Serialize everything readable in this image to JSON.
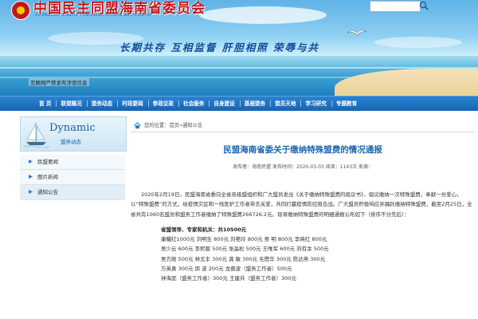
{
  "header": {
    "site_title": "中国民主同盟海南省委员会",
    "site_subtitle": "ZHONGGUO MINZHU TONGMENG HAINAN WEIYUANHUI",
    "slogan": "长期共存  互相监督  肝胆相照  荣辱与共",
    "notice": "互联网严禁发布涉密信息",
    "search_placeholder": ""
  },
  "nav": {
    "items": [
      "首 页",
      "联盟概况",
      "盟务动态",
      "时政要闻",
      "参政议政",
      "社会服务",
      "自身建设",
      "基层盟务",
      "盟员天地",
      "学习研究",
      "专题教育"
    ]
  },
  "sidebar": {
    "dynamic_title": "Dynamic",
    "dynamic_subtitle": "盟务动态",
    "items": [
      {
        "label": "民盟要闻",
        "active": false
      },
      {
        "label": "图片新闻",
        "active": false
      },
      {
        "label": "通知公告",
        "active": true
      }
    ]
  },
  "breadcrumb": {
    "prefix": "您的位置：",
    "path": "首页»通知公告"
  },
  "article": {
    "title": "民盟海南省委关于缴纳特殊盟费的情况通报",
    "meta": "发布者：海南民盟   发布时间：2020-03-03   阅读：1143次   来源：",
    "paragraph": "2020年2月19日，民盟海南省委向全省各级盟组织和广大盟员发出《关于缴纳特殊盟费的倡议书》，倡议缴纳一次特殊盟费，奉献一份爱心，以“特殊盟费”的方式，给疫情灾区和一线医护工作者带去关爱，共同打赢疫情防控阻击战。广大盟员积极响应并踊跃缴纳特殊盟费，截至2月25日，全省共有1060名盟员和盟务工作者缴纳了特殊盟费266726.2元。现将缴纳特殊盟费的明细通报公布如下（排序不分先后）：",
    "section_title": "省盟领导、专家和机关：共10500元",
    "donor_lines": [
      "康耀红1000元   刘明生 800元   刘艳玲 800元   吴  明 800元   李映红 800元",
      "吴少云 600元   李熙蓉 500元   张晶松 500元   王唯军 600元   刘有余 500元",
      "吴方刚 500元   林尤丰 300元   龚  敏 300元   毛懋华 300元   陈达燕 300元",
      "万英勇 300元   邱  波 200元   龙蓉波（盟务工作者）500元",
      "钟海武（盟务工作者）300元   王建兵（盟务工作者）300元"
    ]
  },
  "colors": {
    "nav_blue": "#1b6fc0",
    "title_blue": "#1b64b0",
    "site_red": "#c4161c"
  },
  "icons": [
    "search-icon",
    "home-icon",
    "bullet-icon",
    "sailboat-icon",
    "seagull-icon"
  ]
}
